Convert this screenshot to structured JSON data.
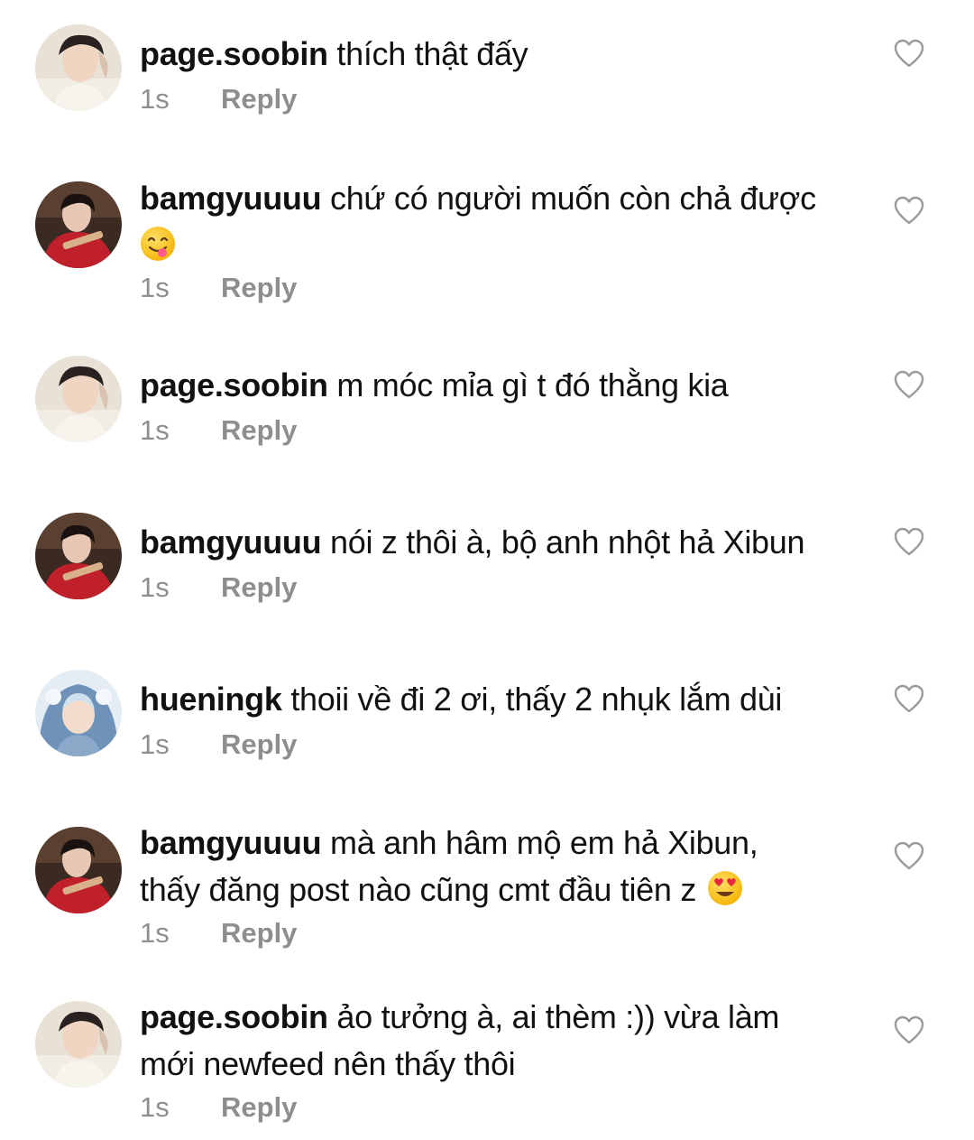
{
  "comments": [
    {
      "username": "page.soobin",
      "text": "thích thật đấy",
      "emoji": "",
      "time": "1s",
      "reply_label": "Reply",
      "avatar": "soobin"
    },
    {
      "username": "bamgyuuuu",
      "text": "chứ có người muốn còn chả được",
      "emoji": "yum-face-emoji",
      "time": "1s",
      "reply_label": "Reply",
      "avatar": "beomgyu"
    },
    {
      "username": "page.soobin",
      "text": "m móc mỉa gì t đó thằng kia",
      "emoji": "",
      "time": "1s",
      "reply_label": "Reply",
      "avatar": "soobin"
    },
    {
      "username": "bamgyuuuu",
      "text": "nói z thôi à, bộ anh nhột hả Xibun",
      "emoji": "",
      "time": "1s",
      "reply_label": "Reply",
      "avatar": "beomgyu"
    },
    {
      "username": "hueningk",
      "text": "thoii về đi 2 ơi, thấy 2 nhụk lắm dùi",
      "emoji": "",
      "time": "1s",
      "reply_label": "Reply",
      "avatar": "huening"
    },
    {
      "username": "bamgyuuuu",
      "text": "mà anh hâm mộ em hả Xibun, thấy đăng post nào cũng cmt đầu tiên z",
      "emoji": "heart-eyes-emoji",
      "time": "1s",
      "reply_label": "Reply",
      "avatar": "beomgyu"
    },
    {
      "username": "page.soobin",
      "text": "ảo tưởng à, ai thèm :)) vừa làm mới newfeed nên thấy thôi",
      "emoji": "",
      "time": "1s",
      "reply_label": "Reply",
      "avatar": "soobin"
    }
  ],
  "icons": {
    "like": "heart-outline-icon"
  },
  "colors": {
    "text": "#111111",
    "meta": "#8e8e8e",
    "heart_stroke": "#9a9a9a"
  }
}
